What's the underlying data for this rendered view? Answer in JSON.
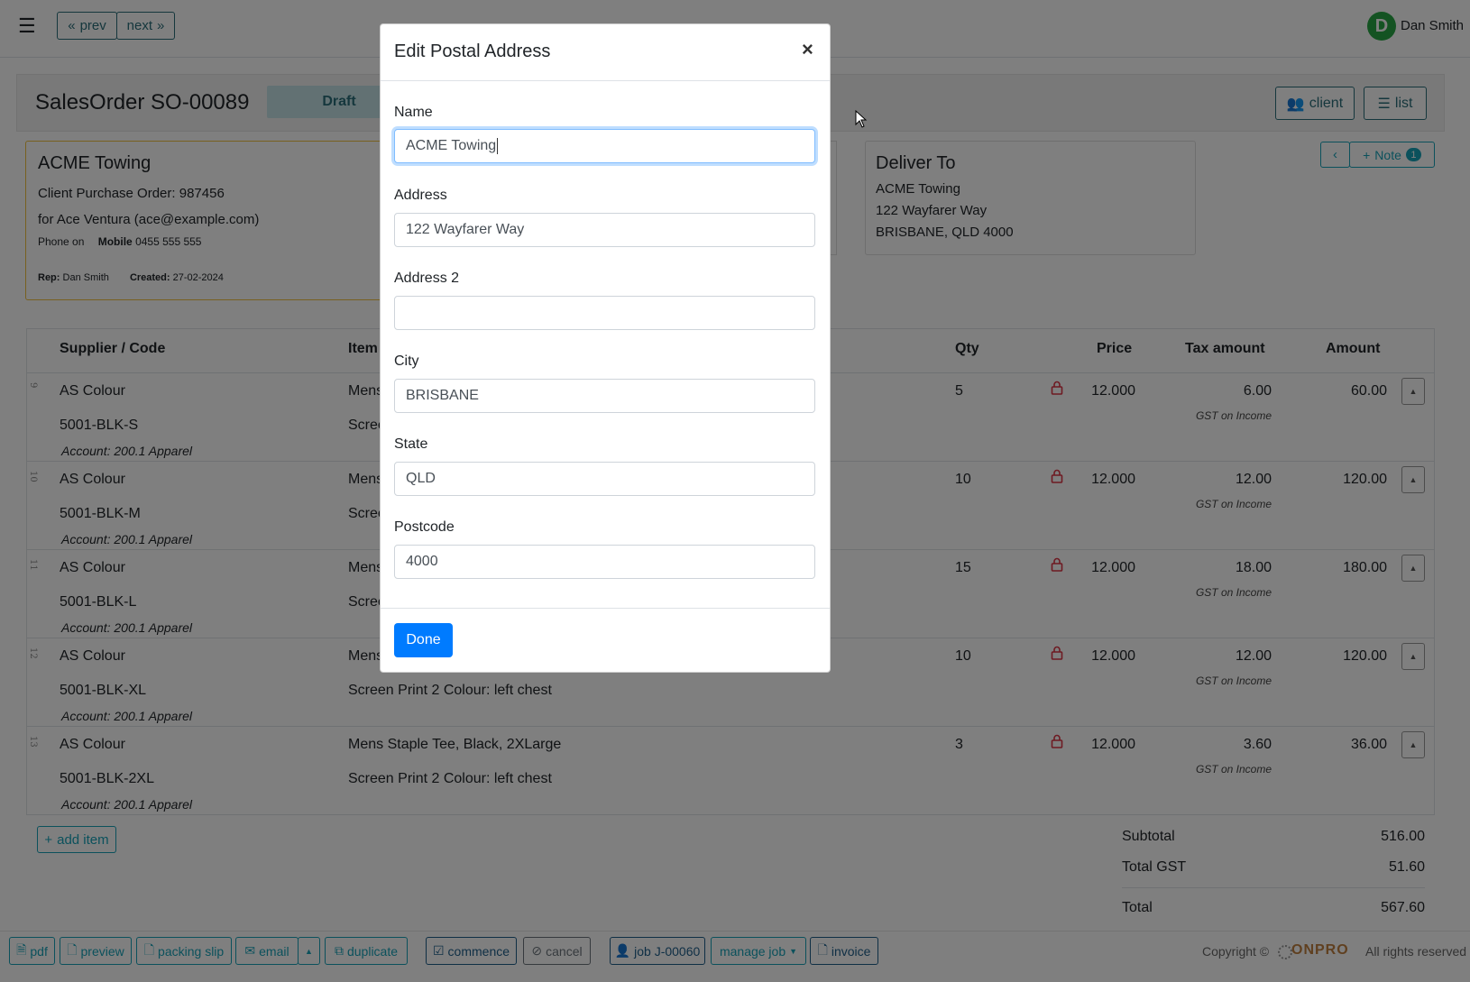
{
  "navbar": {
    "prev": "prev",
    "next": "next",
    "user_initial": "D",
    "user_name": "Dan Smith"
  },
  "order": {
    "title": "SalesOrder SO-00089",
    "status": "Draft",
    "client_btn": "client",
    "list_btn": "list"
  },
  "client": {
    "name": "ACME Towing",
    "po": "Client Purchase Order: 987456",
    "contact": "for Ace Ventura (ace@example.com)",
    "phone_prefix": "Phone on",
    "mobile_label": "Mobile",
    "mobile": "0455 555 555",
    "rep_label": "Rep:",
    "rep": "Dan Smith",
    "created_label": "Created:",
    "created": "27-02-2024"
  },
  "deliver": {
    "heading": "Deliver To",
    "line1": "ACME Towing",
    "line2": "122 Wayfarer Way",
    "line3": "BRISBANE, QLD 4000"
  },
  "note": {
    "label": "Note",
    "count": "1"
  },
  "table": {
    "headers": {
      "supplier": "Supplier / Code",
      "item": "Item",
      "qty": "Qty",
      "price": "Price",
      "tax": "Tax amount",
      "amount": "Amount"
    },
    "rows": [
      {
        "num": "9",
        "supplier": "AS Colour",
        "code": "5001-BLK-S",
        "item1": "Mens",
        "item2": "Scree",
        "account": "Account: 200.1 Apparel",
        "qty": "5",
        "price": "12.000",
        "tax": "6.00",
        "tax_label": "GST on Income",
        "amount": "60.00"
      },
      {
        "num": "10",
        "supplier": "AS Colour",
        "code": "5001-BLK-M",
        "item1": "Mens",
        "item2": "Scree",
        "account": "Account: 200.1 Apparel",
        "qty": "10",
        "price": "12.000",
        "tax": "12.00",
        "tax_label": "GST on Income",
        "amount": "120.00"
      },
      {
        "num": "11",
        "supplier": "AS Colour",
        "code": "5001-BLK-L",
        "item1": "Mens",
        "item2": "Scree",
        "account": "Account: 200.1 Apparel",
        "qty": "15",
        "price": "12.000",
        "tax": "18.00",
        "tax_label": "GST on Income",
        "amount": "180.00"
      },
      {
        "num": "12",
        "supplier": "AS Colour",
        "code": "5001-BLK-XL",
        "item1": "Mens",
        "item2": "Screen Print 2 Colour: left chest",
        "account": "Account: 200.1 Apparel",
        "qty": "10",
        "price": "12.000",
        "tax": "12.00",
        "tax_label": "GST on Income",
        "amount": "120.00"
      },
      {
        "num": "13",
        "supplier": "AS Colour",
        "code": "5001-BLK-2XL",
        "item1": "Mens Staple Tee, Black, 2XLarge",
        "item2": "Screen Print 2 Colour: left chest",
        "account": "Account: 200.1 Apparel",
        "qty": "3",
        "price": "12.000",
        "tax": "3.60",
        "tax_label": "GST on Income",
        "amount": "36.00"
      }
    ]
  },
  "add_item": "add item",
  "totals": {
    "subtotal_label": "Subtotal",
    "subtotal": "516.00",
    "gst_label": "Total GST",
    "gst": "51.60",
    "total_label": "Total",
    "total": "567.60"
  },
  "footer": {
    "pdf": "pdf",
    "preview": "preview",
    "packing_slip": "packing slip",
    "email": "email",
    "duplicate": "duplicate",
    "commence": "commence",
    "cancel": "cancel",
    "job": "job J-00060",
    "manage_job": "manage job",
    "invoice": "invoice",
    "copyright": "Copyright ©",
    "brand": "ONPRO",
    "rights": "All rights reserved"
  },
  "modal": {
    "title": "Edit Postal Address",
    "close": "×",
    "name_label": "Name",
    "name_value": "ACME Towing",
    "address_label": "Address",
    "address_value": "122 Wayfarer Way",
    "address2_label": "Address 2",
    "address2_value": "",
    "city_label": "City",
    "city_value": "BRISBANE",
    "state_label": "State",
    "state_value": "QLD",
    "postcode_label": "Postcode",
    "postcode_value": "4000",
    "done": "Done"
  },
  "colors": {
    "accent": "#17a2b8",
    "primary": "#007bff",
    "status_bg": "#c5e2e6",
    "lock": "#dc3545"
  }
}
